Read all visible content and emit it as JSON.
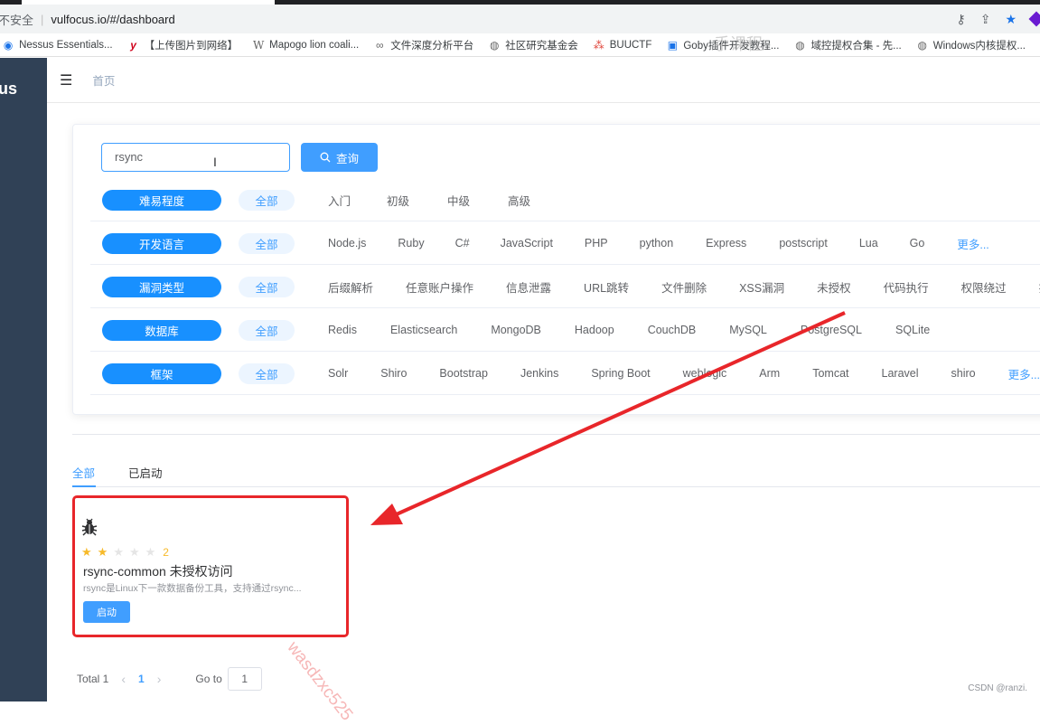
{
  "browser": {
    "insecure_label": "不安全",
    "url": "vulfocus.io/#/dashboard",
    "bookmarks": [
      {
        "icon": "nessus-icon",
        "label": "Nessus Essentials..."
      },
      {
        "icon": "y-icon",
        "label": "【上传图片到网络】"
      },
      {
        "icon": "wikipedia-icon",
        "label": "Mapogo lion coali..."
      },
      {
        "icon": "link-icon",
        "label": "文件深度分析平台"
      },
      {
        "icon": "globe-icon",
        "label": "社区研究基金会"
      },
      {
        "icon": "ctf-icon",
        "label": "BUUCTF"
      },
      {
        "icon": "bilibili-icon",
        "label": "Goby插件开发教程..."
      },
      {
        "icon": "globe-icon",
        "label": "域控提权合集 - 先..."
      },
      {
        "icon": "globe-icon",
        "label": "Windows内核提权..."
      }
    ]
  },
  "sidebar": {
    "logo_text": "us"
  },
  "navbar": {
    "breadcrumb": "首页"
  },
  "search": {
    "value": "rsync",
    "button_label": "查询"
  },
  "filters": [
    {
      "label": "难易程度",
      "all": "全部",
      "options": [
        "入门",
        "初级",
        "中级",
        "高级"
      ],
      "more": ""
    },
    {
      "label": "开发语言",
      "all": "全部",
      "options": [
        "Node.js",
        "Ruby",
        "C#",
        "JavaScript",
        "PHP",
        "python",
        "Express",
        "postscript",
        "Lua",
        "Go"
      ],
      "more": "更多..."
    },
    {
      "label": "漏洞类型",
      "all": "全部",
      "options": [
        "后缀解析",
        "任意账户操作",
        "信息泄露",
        "URL跳转",
        "文件删除",
        "XSS漏洞",
        "未授权",
        "代码执行",
        "权限绕过",
        "拒绝"
      ],
      "more": ""
    },
    {
      "label": "数据库",
      "all": "全部",
      "options": [
        "Redis",
        "Elasticsearch",
        "MongoDB",
        "Hadoop",
        "CouchDB",
        "MySQL",
        "PostgreSQL",
        "SQLite"
      ],
      "more": ""
    },
    {
      "label": "框架",
      "all": "全部",
      "options": [
        "Solr",
        "Shiro",
        "Bootstrap",
        "Jenkins",
        "Spring Boot",
        "weblogic",
        "Arm",
        "Tomcat",
        "Laravel",
        "shiro"
      ],
      "more": "更多..."
    }
  ],
  "tabs": {
    "all": "全部",
    "started": "已启动"
  },
  "card": {
    "rating": 2,
    "rating_text": "2",
    "title": "rsync-common 未授权访问",
    "description": "rsync是Linux下一款数据备份工具，支持通过rsync...",
    "start_label": "启动"
  },
  "pagination": {
    "total": "Total 1",
    "current": "1",
    "goto_label": "Go to",
    "goto_value": "1"
  },
  "watermark": "wasdzxc525",
  "overlay_text": "手课程",
  "footer": "CSDN @ranzi."
}
